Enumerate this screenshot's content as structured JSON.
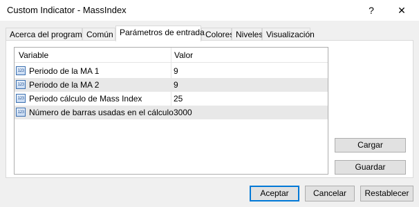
{
  "window": {
    "title": "Custom Indicator - MassIndex",
    "help_glyph": "?",
    "close_glyph": "✕"
  },
  "tabs": [
    {
      "label": "Acerca del programa",
      "active": false
    },
    {
      "label": "Común",
      "active": false
    },
    {
      "label": "Parámetros de entrada",
      "active": true
    },
    {
      "label": "Colores",
      "active": false
    },
    {
      "label": "Niveles",
      "active": false
    },
    {
      "label": "Visualización",
      "active": false
    }
  ],
  "params_table": {
    "columns": [
      "Variable",
      "Valor"
    ],
    "rows": [
      {
        "icon": "int-param-icon",
        "icon_text": "123",
        "variable": "Periodo de la MA 1",
        "value": "9"
      },
      {
        "icon": "int-param-icon",
        "icon_text": "123",
        "variable": "Periodo de la MA 2",
        "value": "9"
      },
      {
        "icon": "int-param-icon",
        "icon_text": "123",
        "variable": "Periodo cálculo de Mass Index",
        "value": "25"
      },
      {
        "icon": "int-param-icon",
        "icon_text": "123",
        "variable": "Número de barras usadas en el cálculo",
        "value": "3000"
      }
    ]
  },
  "side_buttons": {
    "load": "Cargar",
    "save": "Guardar"
  },
  "footer_buttons": {
    "accept": "Aceptar",
    "cancel": "Cancelar",
    "reset": "Restablecer"
  },
  "colors": {
    "accent": "#0078d7",
    "row_alt": "#e8e8e8",
    "button_bg": "#e1e1e1"
  }
}
